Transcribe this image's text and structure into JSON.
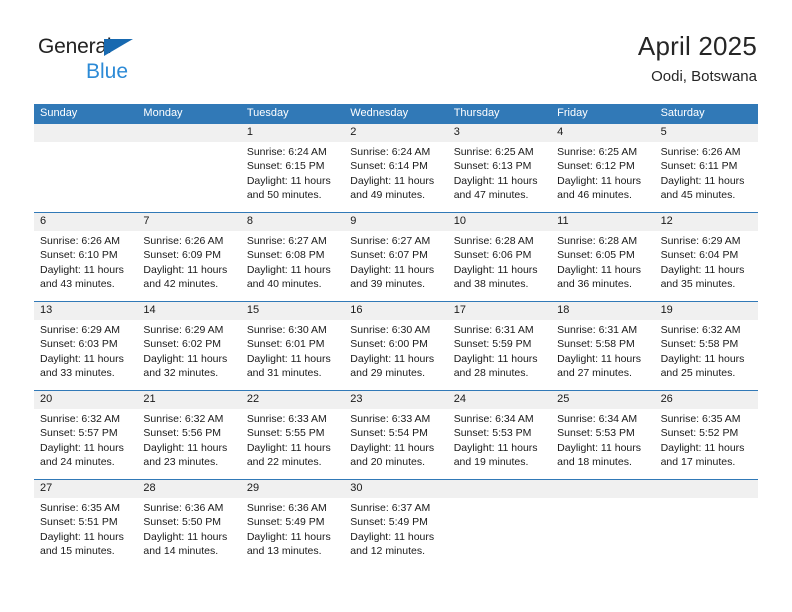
{
  "brand": {
    "name_part1": "General",
    "name_part2": "Blue",
    "triangle_color": "#1769b0",
    "blue_text_color": "#2c8ad6"
  },
  "header": {
    "title": "April 2025",
    "subtitle": "Oodi, Botswana"
  },
  "theme": {
    "header_blue": "#3179b7",
    "date_band_gray": "#f0f0f0",
    "text_color": "#1a1a1a"
  },
  "weekdays": [
    "Sunday",
    "Monday",
    "Tuesday",
    "Wednesday",
    "Thursday",
    "Friday",
    "Saturday"
  ],
  "calendar": {
    "month": "April",
    "year": 2025,
    "weeks": [
      [
        {
          "day": "",
          "lines": []
        },
        {
          "day": "",
          "lines": []
        },
        {
          "day": "1",
          "lines": [
            "Sunrise: 6:24 AM",
            "Sunset: 6:15 PM",
            "Daylight: 11 hours",
            "and 50 minutes."
          ]
        },
        {
          "day": "2",
          "lines": [
            "Sunrise: 6:24 AM",
            "Sunset: 6:14 PM",
            "Daylight: 11 hours",
            "and 49 minutes."
          ]
        },
        {
          "day": "3",
          "lines": [
            "Sunrise: 6:25 AM",
            "Sunset: 6:13 PM",
            "Daylight: 11 hours",
            "and 47 minutes."
          ]
        },
        {
          "day": "4",
          "lines": [
            "Sunrise: 6:25 AM",
            "Sunset: 6:12 PM",
            "Daylight: 11 hours",
            "and 46 minutes."
          ]
        },
        {
          "day": "5",
          "lines": [
            "Sunrise: 6:26 AM",
            "Sunset: 6:11 PM",
            "Daylight: 11 hours",
            "and 45 minutes."
          ]
        }
      ],
      [
        {
          "day": "6",
          "lines": [
            "Sunrise: 6:26 AM",
            "Sunset: 6:10 PM",
            "Daylight: 11 hours",
            "and 43 minutes."
          ]
        },
        {
          "day": "7",
          "lines": [
            "Sunrise: 6:26 AM",
            "Sunset: 6:09 PM",
            "Daylight: 11 hours",
            "and 42 minutes."
          ]
        },
        {
          "day": "8",
          "lines": [
            "Sunrise: 6:27 AM",
            "Sunset: 6:08 PM",
            "Daylight: 11 hours",
            "and 40 minutes."
          ]
        },
        {
          "day": "9",
          "lines": [
            "Sunrise: 6:27 AM",
            "Sunset: 6:07 PM",
            "Daylight: 11 hours",
            "and 39 minutes."
          ]
        },
        {
          "day": "10",
          "lines": [
            "Sunrise: 6:28 AM",
            "Sunset: 6:06 PM",
            "Daylight: 11 hours",
            "and 38 minutes."
          ]
        },
        {
          "day": "11",
          "lines": [
            "Sunrise: 6:28 AM",
            "Sunset: 6:05 PM",
            "Daylight: 11 hours",
            "and 36 minutes."
          ]
        },
        {
          "day": "12",
          "lines": [
            "Sunrise: 6:29 AM",
            "Sunset: 6:04 PM",
            "Daylight: 11 hours",
            "and 35 minutes."
          ]
        }
      ],
      [
        {
          "day": "13",
          "lines": [
            "Sunrise: 6:29 AM",
            "Sunset: 6:03 PM",
            "Daylight: 11 hours",
            "and 33 minutes."
          ]
        },
        {
          "day": "14",
          "lines": [
            "Sunrise: 6:29 AM",
            "Sunset: 6:02 PM",
            "Daylight: 11 hours",
            "and 32 minutes."
          ]
        },
        {
          "day": "15",
          "lines": [
            "Sunrise: 6:30 AM",
            "Sunset: 6:01 PM",
            "Daylight: 11 hours",
            "and 31 minutes."
          ]
        },
        {
          "day": "16",
          "lines": [
            "Sunrise: 6:30 AM",
            "Sunset: 6:00 PM",
            "Daylight: 11 hours",
            "and 29 minutes."
          ]
        },
        {
          "day": "17",
          "lines": [
            "Sunrise: 6:31 AM",
            "Sunset: 5:59 PM",
            "Daylight: 11 hours",
            "and 28 minutes."
          ]
        },
        {
          "day": "18",
          "lines": [
            "Sunrise: 6:31 AM",
            "Sunset: 5:58 PM",
            "Daylight: 11 hours",
            "and 27 minutes."
          ]
        },
        {
          "day": "19",
          "lines": [
            "Sunrise: 6:32 AM",
            "Sunset: 5:58 PM",
            "Daylight: 11 hours",
            "and 25 minutes."
          ]
        }
      ],
      [
        {
          "day": "20",
          "lines": [
            "Sunrise: 6:32 AM",
            "Sunset: 5:57 PM",
            "Daylight: 11 hours",
            "and 24 minutes."
          ]
        },
        {
          "day": "21",
          "lines": [
            "Sunrise: 6:32 AM",
            "Sunset: 5:56 PM",
            "Daylight: 11 hours",
            "and 23 minutes."
          ]
        },
        {
          "day": "22",
          "lines": [
            "Sunrise: 6:33 AM",
            "Sunset: 5:55 PM",
            "Daylight: 11 hours",
            "and 22 minutes."
          ]
        },
        {
          "day": "23",
          "lines": [
            "Sunrise: 6:33 AM",
            "Sunset: 5:54 PM",
            "Daylight: 11 hours",
            "and 20 minutes."
          ]
        },
        {
          "day": "24",
          "lines": [
            "Sunrise: 6:34 AM",
            "Sunset: 5:53 PM",
            "Daylight: 11 hours",
            "and 19 minutes."
          ]
        },
        {
          "day": "25",
          "lines": [
            "Sunrise: 6:34 AM",
            "Sunset: 5:53 PM",
            "Daylight: 11 hours",
            "and 18 minutes."
          ]
        },
        {
          "day": "26",
          "lines": [
            "Sunrise: 6:35 AM",
            "Sunset: 5:52 PM",
            "Daylight: 11 hours",
            "and 17 minutes."
          ]
        }
      ],
      [
        {
          "day": "27",
          "lines": [
            "Sunrise: 6:35 AM",
            "Sunset: 5:51 PM",
            "Daylight: 11 hours",
            "and 15 minutes."
          ]
        },
        {
          "day": "28",
          "lines": [
            "Sunrise: 6:36 AM",
            "Sunset: 5:50 PM",
            "Daylight: 11 hours",
            "and 14 minutes."
          ]
        },
        {
          "day": "29",
          "lines": [
            "Sunrise: 6:36 AM",
            "Sunset: 5:49 PM",
            "Daylight: 11 hours",
            "and 13 minutes."
          ]
        },
        {
          "day": "30",
          "lines": [
            "Sunrise: 6:37 AM",
            "Sunset: 5:49 PM",
            "Daylight: 11 hours",
            "and 12 minutes."
          ]
        },
        {
          "day": "",
          "lines": []
        },
        {
          "day": "",
          "lines": []
        },
        {
          "day": "",
          "lines": []
        }
      ]
    ]
  }
}
